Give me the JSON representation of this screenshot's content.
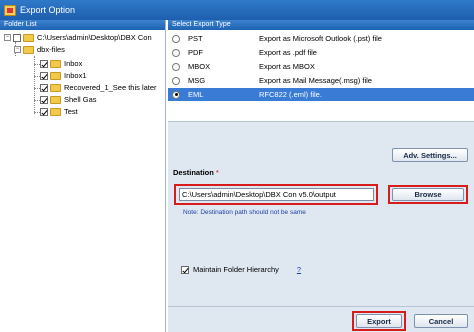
{
  "window": {
    "title": "Export Option"
  },
  "folder_list": {
    "header": "Folder List",
    "root": "C:\\Users\\admin\\Desktop\\DBX Con",
    "child": "dbx-files",
    "items": [
      "Inbox",
      "Inbox1",
      "Recovered_1_See this later",
      "Shell Gas",
      "Test"
    ]
  },
  "export_type": {
    "header": "Select Export Type",
    "options": [
      {
        "name": "PST",
        "desc": "Export as Microsoft Outlook (.pst) file"
      },
      {
        "name": "PDF",
        "desc": "Export as .pdf file"
      },
      {
        "name": "MBOX",
        "desc": "Export as MBOX"
      },
      {
        "name": "MSG",
        "desc": "Export as Mail Message(.msg) file"
      },
      {
        "name": "EML",
        "desc": "RFC822 (.eml) file."
      }
    ],
    "selected": "EML"
  },
  "adv_settings_label": "Adv. Settings...",
  "destination": {
    "label": "Destination",
    "required_mark": "*",
    "value": "C:\\Users\\admin\\Desktop\\DBX Con v5.0\\output",
    "browse_label": "Browse",
    "note": "Note: Destination path should not be same"
  },
  "maintain_folder_hierarchy": {
    "label": "Maintain Folder Hierarchy",
    "checked": true,
    "help": "?"
  },
  "footer": {
    "export_label": "Export",
    "cancel_label": "Cancel"
  },
  "colors": {
    "selection": "#3a7bd5",
    "highlight": "#d81b1b",
    "title_bar": "#1e5fae"
  }
}
